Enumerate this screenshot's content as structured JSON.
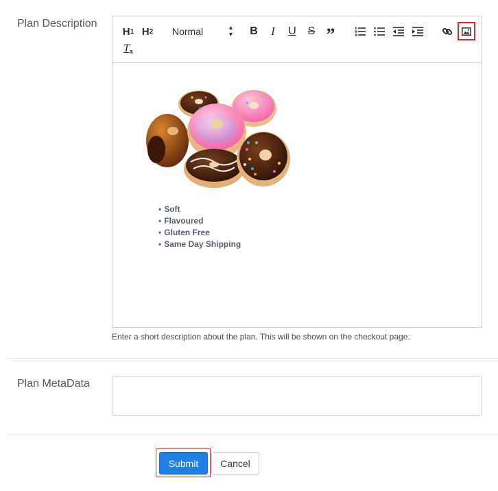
{
  "plan_description": {
    "label": "Plan Description",
    "help_text": "Enter a short description about the plan. This will be shown on the checkout page."
  },
  "toolbar": {
    "h1": "H",
    "h1_sub": "1",
    "h2": "H",
    "h2_sub": "2",
    "format_select": "Normal",
    "highlight_color": "#e0262d"
  },
  "editor_content": {
    "image_alt": "donuts",
    "bullets": [
      "Soft",
      "Flavoured",
      "Gluten Free",
      "Same Day Shipping"
    ]
  },
  "plan_metadata": {
    "label": "Plan MetaData",
    "value": ""
  },
  "actions": {
    "submit_label": "Submit",
    "cancel_label": "Cancel",
    "submit_color": "#1f7fe5"
  }
}
